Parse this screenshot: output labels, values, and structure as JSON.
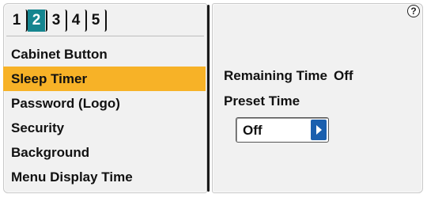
{
  "tabs": [
    {
      "label": "1",
      "active": false
    },
    {
      "label": "2",
      "active": true
    },
    {
      "label": "3",
      "active": false
    },
    {
      "label": "4",
      "active": false
    },
    {
      "label": "5",
      "active": false
    }
  ],
  "menu": {
    "items": [
      {
        "label": "Cabinet Button"
      },
      {
        "label": "Sleep Timer",
        "selected": true
      },
      {
        "label": "Password (Logo)"
      },
      {
        "label": "Security"
      },
      {
        "label": "Background"
      },
      {
        "label": "Menu Display Time"
      }
    ]
  },
  "detail": {
    "remaining_label": "Remaining Time",
    "remaining_value": "Off",
    "preset_label": "Preset Time",
    "preset_value": "Off",
    "help_glyph": "?"
  },
  "colors": {
    "active_tab": "#15858f",
    "selected_item": "#f7b227",
    "arrow_button": "#1a5fae"
  },
  "icons": {
    "help": "help-icon",
    "arrow": "arrow-right-icon"
  }
}
